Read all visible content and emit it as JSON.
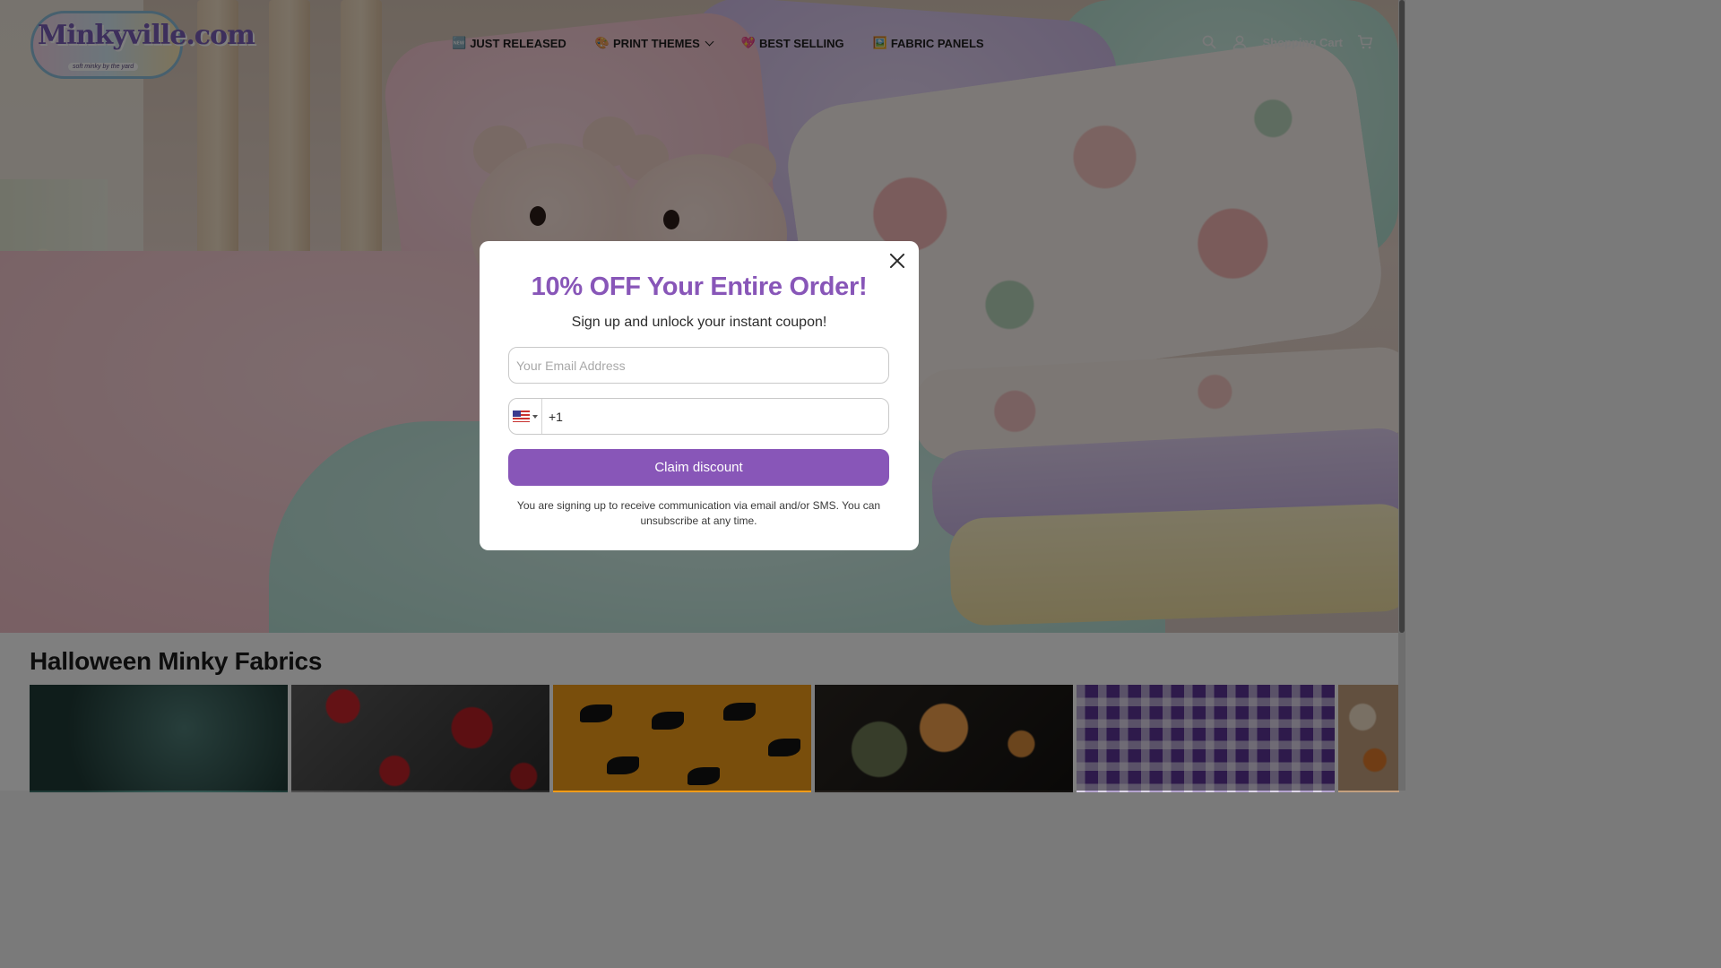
{
  "header": {
    "logo_text": "Minkyville.com",
    "logo_tagline": "soft minky by the yard",
    "nav": [
      {
        "emoji": "🆕",
        "label": "JUST RELEASED"
      },
      {
        "emoji": "🎨",
        "label": "PRINT THEMES"
      },
      {
        "emoji": "💖",
        "label": "BEST SELLING"
      },
      {
        "emoji": "🖼️",
        "label": "FABRIC PANELS"
      }
    ],
    "cart_label": "Shopping Cart",
    "icons": [
      "search-icon",
      "account-icon",
      "cart-icon"
    ]
  },
  "collection": {
    "title": "Halloween Minky Fabrics"
  },
  "modal": {
    "title": "10% OFF Your Entire Order!",
    "subtitle": "Sign up and unlock your instant coupon!",
    "email_placeholder": "Your Email Address",
    "phone_prefix": "+1",
    "country_flag": "us-flag-icon",
    "button_label": "Claim discount",
    "disclaimer": "You are signing up to receive communication via email and/or SMS. You can unsubscribe at any time."
  },
  "colors": {
    "accent": "#8856b8",
    "overlay": "rgba(0,0,0,0.5)"
  }
}
